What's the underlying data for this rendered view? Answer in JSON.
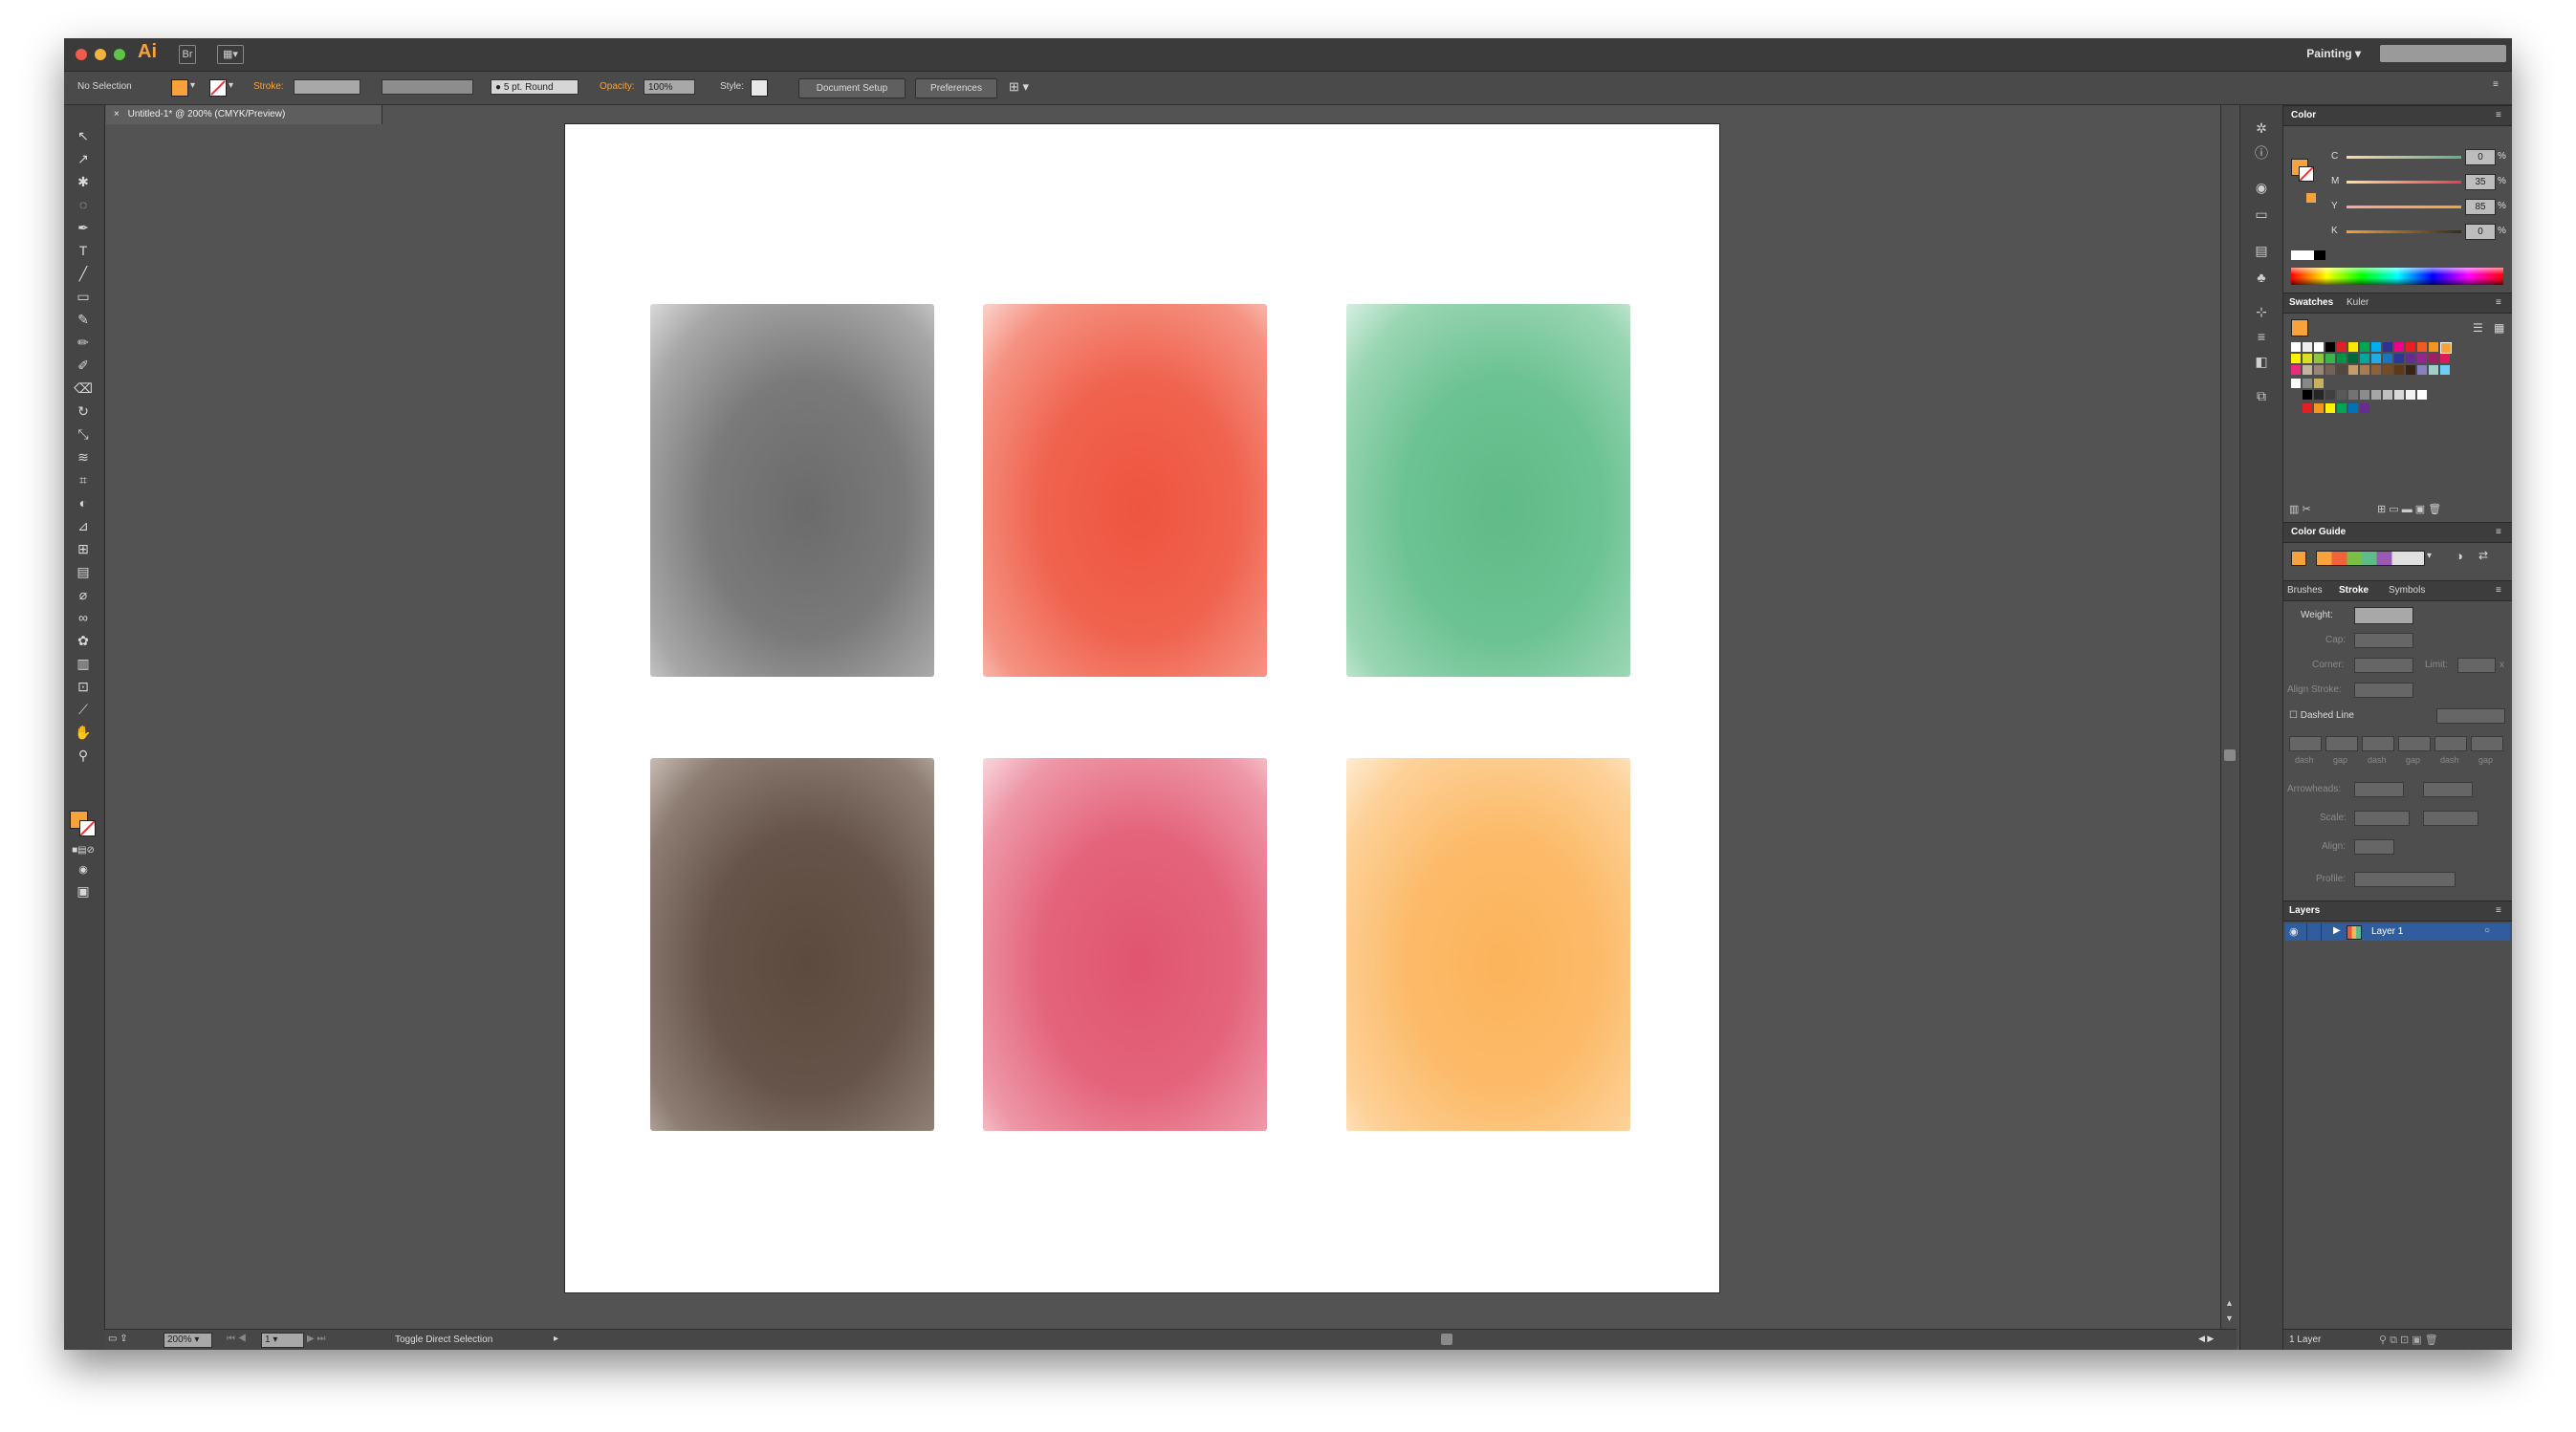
{
  "app": {
    "logo": "Ai",
    "workspace": "Painting"
  },
  "control_bar": {
    "selection": "No Selection",
    "stroke_label": "Stroke:",
    "brush": "5 pt. Round",
    "opacity_label": "Opacity:",
    "opacity_value": "100%",
    "style_label": "Style:",
    "document_setup": "Document Setup",
    "preferences": "Preferences"
  },
  "document": {
    "tab_title": "Untitled-1* @ 200% (CMYK/Preview)"
  },
  "status_bar": {
    "zoom": "200%",
    "artboard": "1",
    "tool_hint": "Toggle Direct Selection"
  },
  "color_panel": {
    "title": "Color",
    "channels": [
      {
        "label": "C",
        "value": "0"
      },
      {
        "label": "M",
        "value": "35"
      },
      {
        "label": "Y",
        "value": "85"
      },
      {
        "label": "K",
        "value": "0"
      }
    ],
    "percent": "%"
  },
  "swatches_panel": {
    "tabs": [
      "Swatches",
      "Kuler"
    ]
  },
  "color_guide_panel": {
    "title": "Color Guide"
  },
  "stroke_panel": {
    "tabs": [
      "Brushes",
      "Stroke",
      "Symbols"
    ],
    "weight_label": "Weight:",
    "cap_label": "Cap:",
    "corner_label": "Corner:",
    "limit_label": "Limit:",
    "limit_unit": "x",
    "align_label": "Align Stroke:",
    "dashed_line": "Dashed Line",
    "dash_labels": [
      "dash",
      "gap",
      "dash",
      "gap",
      "dash",
      "gap"
    ],
    "arrowheads_label": "Arrowheads:",
    "scale_label": "Scale:",
    "align_arrow_label": "Align:",
    "profile_label": "Profile:"
  },
  "layers_panel": {
    "title": "Layers",
    "layer_name": "Layer 1",
    "footer": "1 Layer"
  },
  "colors": {
    "fill": "#f7a23b",
    "samples": [
      "#6b6b6b",
      "#ee5540",
      "#5fbb87",
      "#5c4a3e",
      "#e0556f",
      "#fcb35a"
    ]
  }
}
